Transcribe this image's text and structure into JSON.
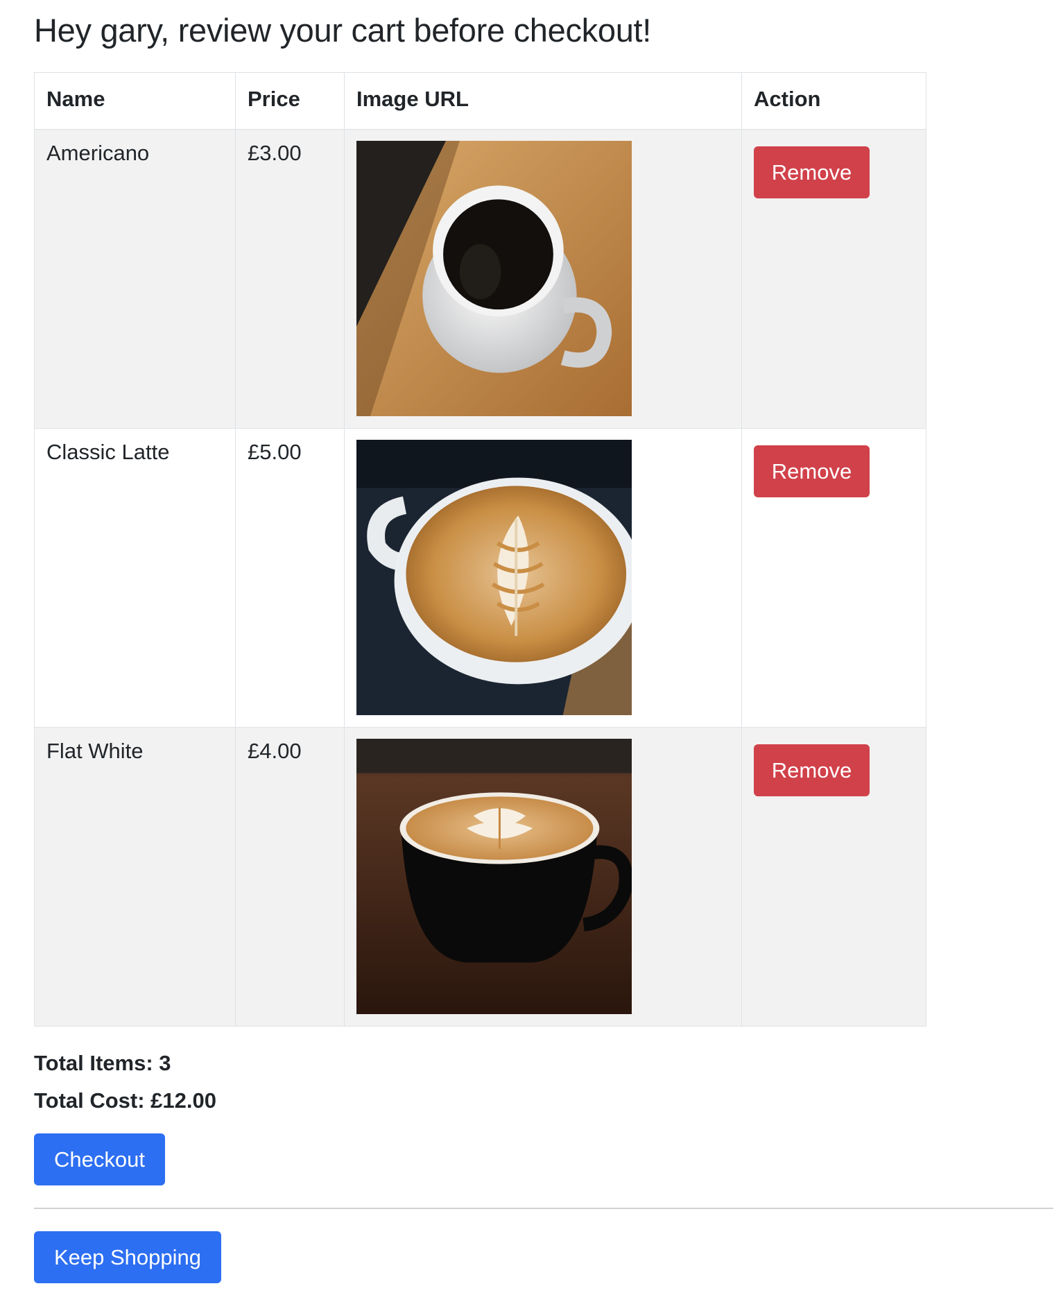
{
  "page": {
    "greeting": "Hey gary, review your cart before checkout!"
  },
  "cart": {
    "headers": {
      "name": "Name",
      "price": "Price",
      "image": "Image URL",
      "action": "Action"
    },
    "items": [
      {
        "name": "Americano",
        "price": "£3.00",
        "image_icon": "americano-photo",
        "remove_label": "Remove"
      },
      {
        "name": "Classic Latte",
        "price": "£5.00",
        "image_icon": "latte-photo",
        "remove_label": "Remove"
      },
      {
        "name": "Flat White",
        "price": "£4.00",
        "image_icon": "flat-white-photo",
        "remove_label": "Remove"
      }
    ]
  },
  "summary": {
    "total_items": "Total Items: 3",
    "total_cost": "Total Cost: £12.00"
  },
  "actions": {
    "checkout_label": "Checkout",
    "keep_shopping_label": "Keep Shopping"
  },
  "colors": {
    "remove_button": "#d1414a",
    "primary_button": "#2d6ff2",
    "striped_row": "#f2f2f2"
  }
}
